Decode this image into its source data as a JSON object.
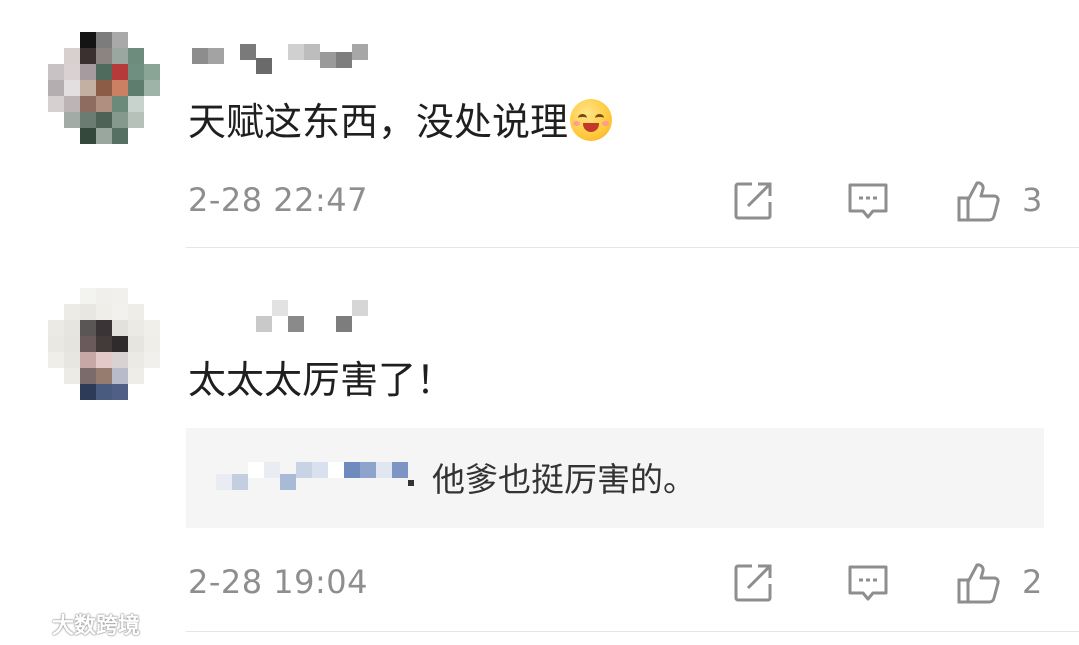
{
  "comments": [
    {
      "text": "天赋这东西，没处说理",
      "emoji": "grinning-blush-emoji",
      "time": "2-28 22:47",
      "like_count": "3"
    },
    {
      "text": "太太太厉害了！",
      "reply": {
        "text": "他爹也挺厉害的。"
      },
      "time": "2-28 19:04",
      "like_count": "2"
    }
  ],
  "icons": {
    "share": "share-icon",
    "comment": "comment-icon",
    "like": "thumbs-up-icon"
  },
  "colors": {
    "text": "#1f1f1f",
    "meta": "#8e8e8e",
    "reply_bg": "#f5f5f5",
    "divider": "#e5e5e5"
  },
  "watermark": {
    "text": "大数跨境"
  }
}
